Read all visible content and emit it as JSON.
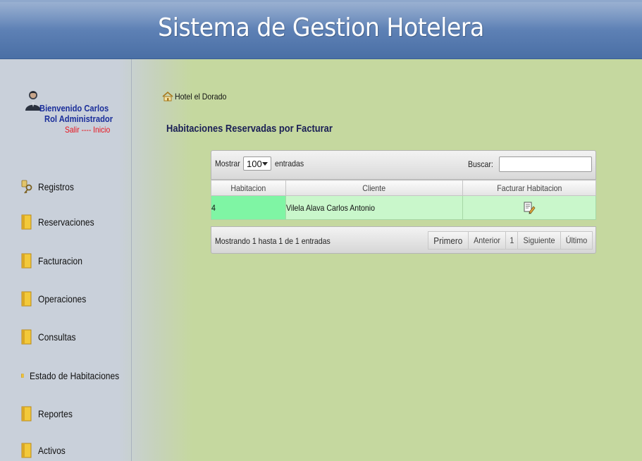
{
  "app": {
    "title": "Sistema de Gestion Hotelera"
  },
  "user": {
    "welcome": "Bienvenido Carlos",
    "role": "Rol Administrador",
    "links": "Salir ---- Inicio"
  },
  "sidebar": {
    "items": [
      {
        "label": "Registros",
        "icon": "key-icon"
      },
      {
        "label": "Reservaciones",
        "icon": "folder-icon"
      },
      {
        "label": "Facturacion",
        "icon": "folder-icon"
      },
      {
        "label": "Operaciones",
        "icon": "folder-icon"
      },
      {
        "label": "Consultas",
        "icon": "folder-icon"
      },
      {
        "label": "Estado de Habitaciones",
        "icon": "folder-icon"
      },
      {
        "label": "Reportes",
        "icon": "folder-icon"
      },
      {
        "label": "Activos",
        "icon": "folder-icon"
      }
    ]
  },
  "breadcrumb": {
    "label": "Hotel el Dorado",
    "icon": "home-icon"
  },
  "page": {
    "title": "Habitaciones Reservadas por Facturar"
  },
  "grid": {
    "show_prefix": "Mostrar",
    "show_value": "100",
    "show_suffix": "entradas",
    "search_label": "Buscar:",
    "search_value": "",
    "columns": [
      "Habitacion",
      "Cliente",
      "Facturar Habitacion"
    ],
    "rows": [
      {
        "habitacion": "4",
        "cliente": "Vilela Alava Carlos Antonio",
        "action_icon": "edit-invoice-icon"
      }
    ],
    "info": "Mostrando 1 hasta 1 de 1 entradas",
    "pager": {
      "first": "Primero",
      "previous": "Anterior",
      "page": "1",
      "next": "Siguiente",
      "last": "Último"
    }
  },
  "colors": {
    "header": "#5f82b6",
    "background": "#c5d89f",
    "row": "#c9f7cb",
    "sorted_cell": "#7ff5a4",
    "link_blue": "#1a2e9a",
    "link_red": "#e8121c"
  }
}
